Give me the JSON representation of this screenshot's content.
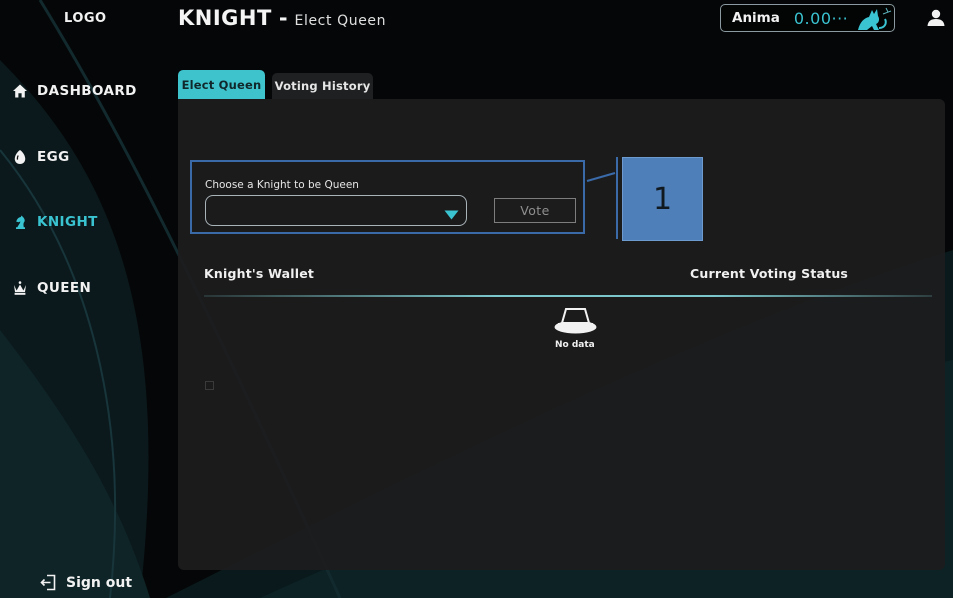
{
  "sidebar": {
    "logo": "LOGO",
    "items": [
      {
        "label": "DASHBOARD",
        "icon": "home-icon"
      },
      {
        "label": "EGG",
        "icon": "egg-icon"
      },
      {
        "label": "KNIGHT",
        "icon": "knight-icon",
        "active": true
      },
      {
        "label": "QUEEN",
        "icon": "crown-icon"
      }
    ],
    "signout": "Sign out"
  },
  "header": {
    "title": "KNIGHT",
    "separator": "-",
    "subtitle": "Elect Queen"
  },
  "wallet": {
    "label": "Anima",
    "value": "0.00···",
    "icon": "cat-icon"
  },
  "tabs": [
    {
      "label": "Elect Queen",
      "active": true
    },
    {
      "label": "Voting History",
      "active": false
    }
  ],
  "form": {
    "label": "Choose a Knight to be Queen",
    "select_value": "",
    "vote_button": "Vote"
  },
  "callout": {
    "number": "1"
  },
  "table": {
    "columns": [
      "Knight's Wallet",
      "Current Voting Status"
    ],
    "empty_text": "No data"
  },
  "colors": {
    "accent": "#3ac3d0",
    "tab_active": "#3ec3cc",
    "callout": "#4f7fb8",
    "panel": "#1c1c1d"
  }
}
